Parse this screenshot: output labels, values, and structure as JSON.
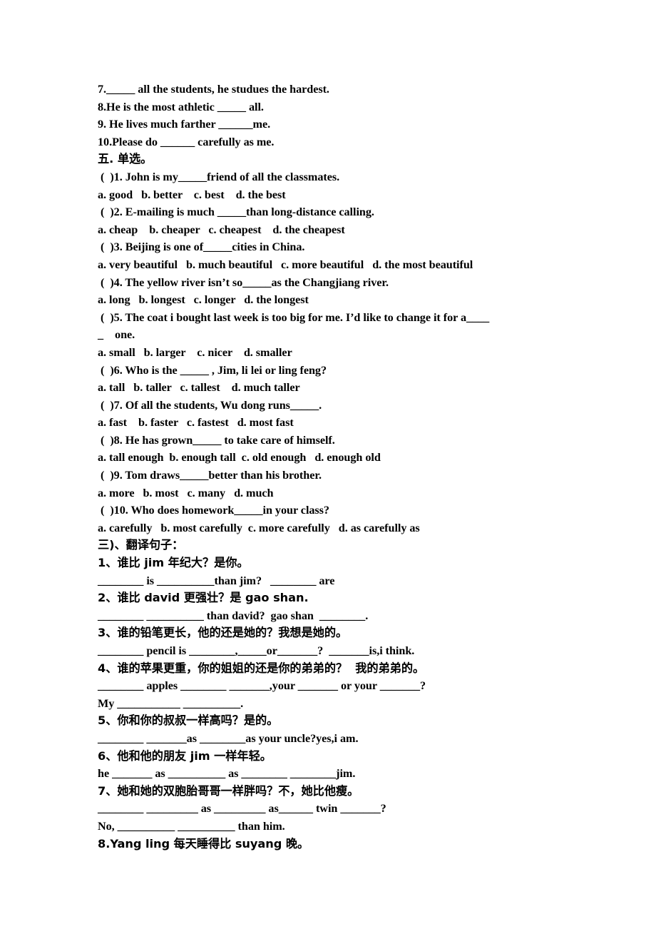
{
  "document": {
    "type": "english-grammar-worksheet",
    "language": "zh-CN+en"
  },
  "fill_in_tail": {
    "items": [
      "7._____ all the students, he studues the hardest.",
      "8.He is the most athletic _____ all.",
      "9. He lives much farther ______me.",
      "10.Please do ______ carefully as me."
    ]
  },
  "section_five": {
    "heading": "五. 单选。",
    "questions": [
      {
        "stem": "(  )1. John is my_____friend of all the classmates.",
        "options": "a. good   b. better    c. best    d. the best"
      },
      {
        "stem": "(  )2. E-mailing is much _____than long-distance calling.",
        "options": "a. cheap    b. cheaper   c. cheapest    d. the cheapest"
      },
      {
        "stem": "(  )3. Beijing is one of_____cities in China.",
        "options": "a. very beautiful   b. much beautiful   c. more beautiful   d. the most beautiful"
      },
      {
        "stem": "(  )4. The yellow river isn’t so_____as the Changjiang river.",
        "options": "a. long   b. longest   c. longer   d. the longest"
      },
      {
        "stem": "(  )5. The coat i bought last week is too big for me. I’d like to change it for a____",
        "stem_continued": "_    one.",
        "options": "a. small   b. larger    c. nicer    d. smaller"
      },
      {
        "stem": "(  )6. Who is the _____ , Jim, li lei or ling feng?",
        "options": "a. tall   b. taller   c. tallest    d. much taller"
      },
      {
        "stem": "(  )7. Of all the students, Wu dong runs_____.",
        "options": "a. fast    b. faster   c. fastest   d. most fast"
      },
      {
        "stem": "(  )8. He has grown_____ to take care of himself.",
        "options": "a. tall enough  b. enough tall  c. old enough   d. enough old"
      },
      {
        "stem": "(  )9. Tom draws_____better than his brother.",
        "options": "a. more   b. most   c. many   d. much"
      },
      {
        "stem": "(  )10. Who does homework_____in your class?",
        "options": "a. carefully   b. most carefully  c. more carefully   d. as carefully as"
      }
    ]
  },
  "section_translate": {
    "heading": "三)、翻译句子：",
    "items": [
      {
        "prompt": "1、谁比 jim 年纪大？是你。",
        "answers": [
          "________ is __________than jim?   ________ are"
        ]
      },
      {
        "prompt": "2、谁比 david 更强壮？是 gao shan.",
        "answers": [
          "________ __________ than david?  gao shan  ________."
        ]
      },
      {
        "prompt": "3、谁的铅笔更长，他的还是她的？我想是她的。",
        "answers": [
          "________ pencil is ________,_____or_______?  _______is,i think."
        ]
      },
      {
        "prompt": "4、谁的苹果更重，你的姐姐的还是你的弟弟的？  我的弟弟的。",
        "answers": [
          "________ apples ________ _______,your _______ or your _______?",
          "My ___________ __________."
        ]
      },
      {
        "prompt": "5、你和你的叔叔一样高吗？是的。",
        "answers": [
          "________ _______as ________as your uncle?yes,i am."
        ]
      },
      {
        "prompt": "6、他和他的朋友 jim 一样年轻。",
        "answers": [
          "he _______ as __________ as ________ ________jim."
        ]
      },
      {
        "prompt": "7、她和她的双胞胎哥哥一样胖吗？不，她比他瘦。",
        "answers": [
          "________ _________ as _________ as______ twin _______?",
          "No, __________ __________ than him."
        ]
      },
      {
        "prompt": "8.Yang ling 每天睡得比 suyang 晚。",
        "answers": []
      }
    ]
  }
}
